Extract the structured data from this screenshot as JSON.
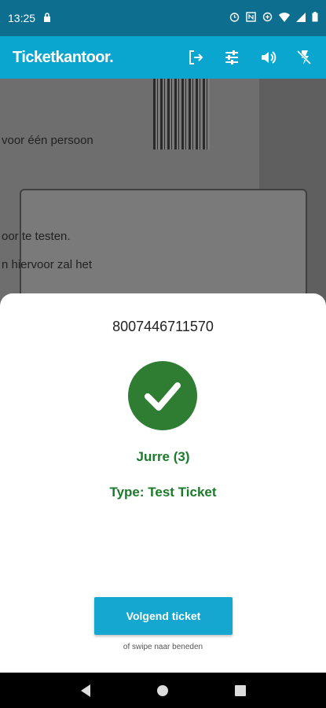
{
  "status_bar": {
    "time": "13:25"
  },
  "app_bar": {
    "logo": "Ticketkantoor."
  },
  "camera_text": [
    "voor één persoon",
    "oor te testen.",
    "n hiervoor zal het"
  ],
  "result": {
    "code": "8007446711570",
    "name": "Jurre (3)",
    "type": "Type: Test Ticket",
    "button": "Volgend ticket",
    "hint": "of swipe naar beneden"
  },
  "colors": {
    "accent": "#0aa6cf",
    "success": "#2e7d32",
    "statusbar": "#0d6e8f"
  }
}
